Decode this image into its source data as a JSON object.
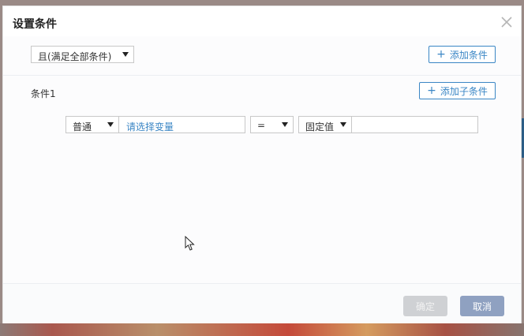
{
  "dialog": {
    "title": "设置条件",
    "close_icon": "close-icon"
  },
  "top_bar": {
    "logic_select": {
      "selected": "且(满足全部条件)"
    },
    "add_condition_label": "添加条件"
  },
  "condition": {
    "label": "条件1",
    "add_sub_condition_label": "添加子条件",
    "type_select": {
      "selected": "普通"
    },
    "variable_input": {
      "placeholder": "请选择变量"
    },
    "operator_select": {
      "selected": "="
    },
    "value_type_select": {
      "selected": "固定值"
    },
    "value_input": {
      "value": ""
    }
  },
  "footer": {
    "confirm_label": "确定",
    "cancel_label": "取消"
  },
  "colors": {
    "accent": "#3a86c5",
    "cancel_button": "#8fa1c1",
    "confirm_disabled": "#cfd1d4"
  }
}
